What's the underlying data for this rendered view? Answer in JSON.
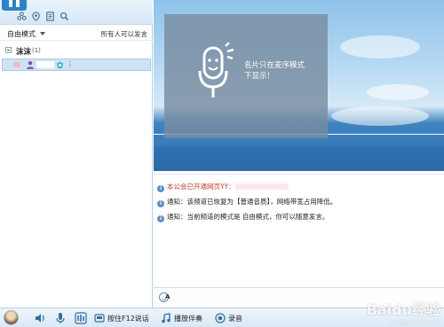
{
  "left_panel": {
    "mode_label": "自由模式",
    "mode_hint": "所有人可以发言",
    "channel": {
      "name": "沫沫",
      "count": "(1)"
    },
    "user": {
      "more": "⋮"
    }
  },
  "video_card": {
    "line1": "名片只在麦序模式",
    "line2": "下显示！"
  },
  "messages": [
    {
      "text": "本公会已开通网页YY：",
      "highlight": true
    },
    {
      "text": "通知：该频道已恢复为【普通音质】，网络带宽占用降低。",
      "highlight": false
    },
    {
      "text": "通知：当前频道的模式是 自由模式，你可以随意发言。",
      "highlight": false
    }
  ],
  "bottom_bar": {
    "press_talk": "按住F12说话",
    "play_music": "播放伴奏",
    "record": "录音"
  },
  "watermark": {
    "main": "Baidu经验",
    "sub": "jingyan.baidu.com"
  },
  "colors": {
    "accent": "#2a84c8",
    "selection": "#cfe3f7",
    "notice_red": "#c0392b"
  }
}
